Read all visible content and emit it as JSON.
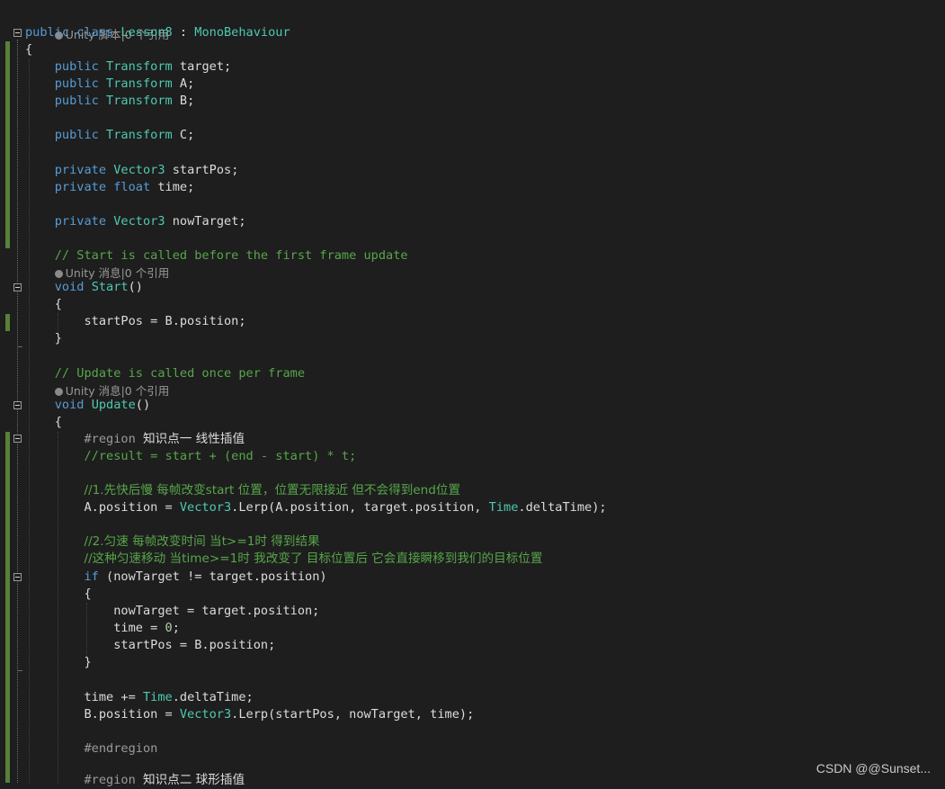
{
  "codelens": {
    "class_refs": "Unity 脚本|0 个引用",
    "start_refs": "Unity 消息|0 个引用",
    "update_refs": "Unity 消息|0 个引用"
  },
  "code": {
    "class_decl": [
      "public",
      "class",
      "Lesson8",
      ":",
      "MonoBehaviour"
    ],
    "field_target": "target;",
    "field_a": "A;",
    "field_b": "B;",
    "field_c": "C;",
    "field_startpos": "startPos;",
    "field_time": "time;",
    "field_nowtarget": "nowTarget;",
    "comment_start": "// Start is called before the first frame update",
    "comment_update": "// Update is called once per frame",
    "start_body": "startPos = B.position;",
    "region1_keyword": "#region",
    "region1_title": "知识点一 线性插值",
    "formula_comment": "//result = start + (end - start) * t;",
    "comment_lerp1": "//1.先快后慢 每帧改变start 位置，位置无限接近 但不会得到end位置",
    "comment_lerp2a": "//2.匀速 每帧改变时间 当t>=1时 得到结果",
    "comment_lerp2b": "//这种匀速移动 当time>=1时 我改变了 目标位置后 它会直接瞬移到我们的目标位置",
    "endregion": "#endregion",
    "region2_keyword": "#region",
    "region2_title": "知识点二 球形插值"
  },
  "kw": {
    "public": "public",
    "private": "private",
    "void": "void",
    "float": "float",
    "if": "if"
  },
  "types": {
    "transform": "Transform",
    "vector3": "Vector3",
    "time": "Time"
  },
  "methods": {
    "start": "Start",
    "update": "Update",
    "lerp": "Lerp"
  },
  "watermark": "CSDN @@Sunset..."
}
